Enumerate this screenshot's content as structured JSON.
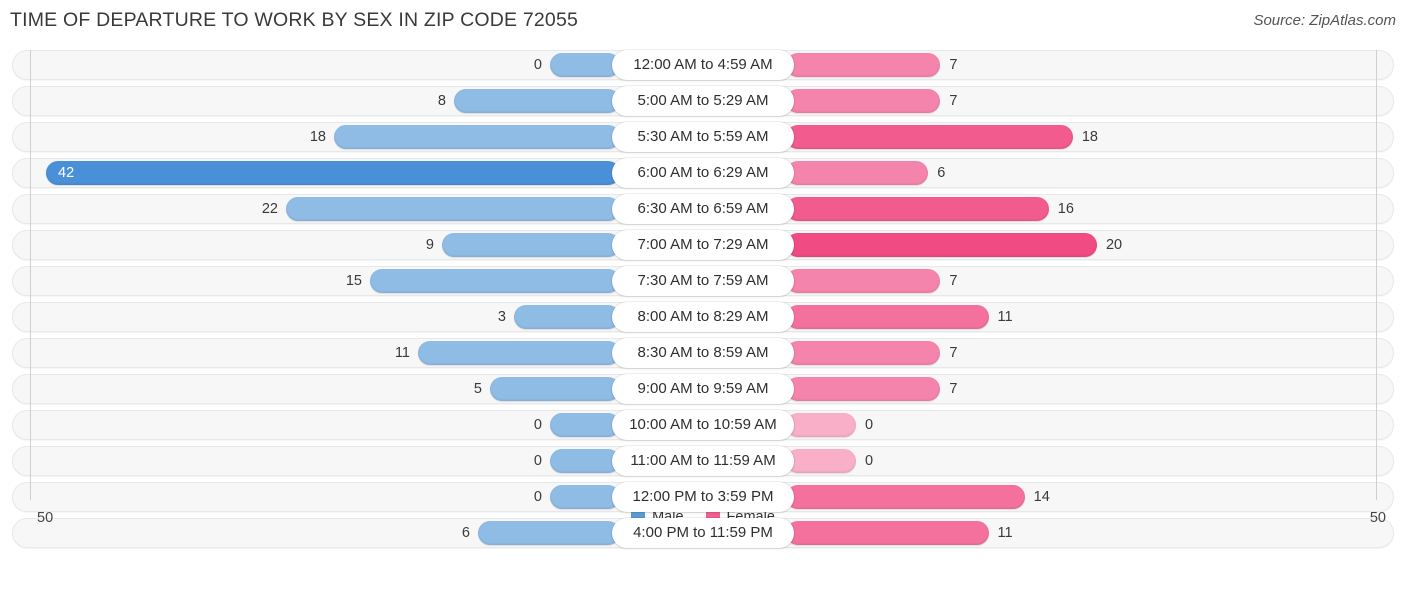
{
  "header": {
    "title": "TIME OF DEPARTURE TO WORK BY SEX IN ZIP CODE 72055",
    "source": "Source: ZipAtlas.com"
  },
  "legend": {
    "male_label": "Male",
    "female_label": "Female",
    "male_color": "#5B9BD5",
    "female_color": "#F0608E"
  },
  "axis": {
    "left_tick": "50",
    "right_tick": "50",
    "max": 50
  },
  "chart_data": {
    "type": "bar",
    "orientation": "horizontal-diverging",
    "title": "TIME OF DEPARTURE TO WORK BY SEX IN ZIP CODE 72055",
    "xlabel": "",
    "ylabel": "",
    "xlim": [
      50,
      50
    ],
    "grid": false,
    "legend_position": "bottom-center",
    "categories": [
      "12:00 AM to 4:59 AM",
      "5:00 AM to 5:29 AM",
      "5:30 AM to 5:59 AM",
      "6:00 AM to 6:29 AM",
      "6:30 AM to 6:59 AM",
      "7:00 AM to 7:29 AM",
      "7:30 AM to 7:59 AM",
      "8:00 AM to 8:29 AM",
      "8:30 AM to 8:59 AM",
      "9:00 AM to 9:59 AM",
      "10:00 AM to 10:59 AM",
      "11:00 AM to 11:59 AM",
      "12:00 PM to 3:59 PM",
      "4:00 PM to 11:59 PM"
    ],
    "series": [
      {
        "name": "Male",
        "color": "#5B9BD5",
        "values": [
          0,
          8,
          18,
          42,
          22,
          9,
          15,
          3,
          11,
          5,
          0,
          0,
          0,
          6
        ]
      },
      {
        "name": "Female",
        "color": "#F0608E",
        "values": [
          7,
          7,
          18,
          6,
          16,
          20,
          7,
          11,
          7,
          7,
          0,
          0,
          14,
          11
        ]
      }
    ]
  }
}
